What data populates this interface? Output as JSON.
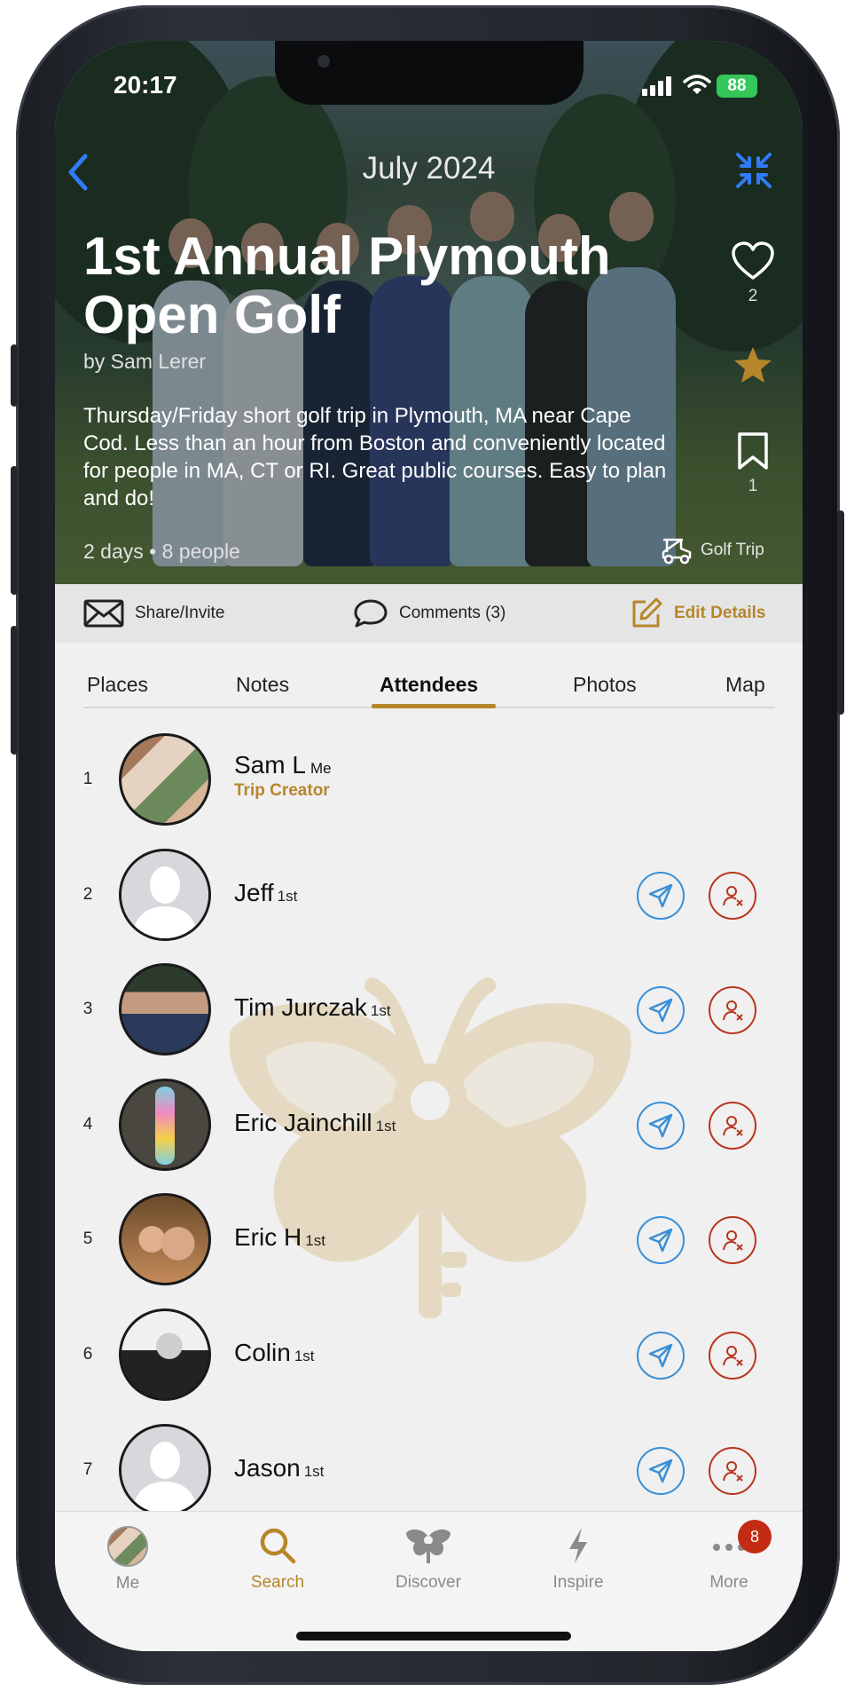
{
  "status_bar": {
    "time": "20:17",
    "battery": "88"
  },
  "header": {
    "title": "July 2024",
    "back_icon": "chevron-left-icon",
    "collapse_icon": "collapse-arrows-icon"
  },
  "trip": {
    "title": "1st Annual Plymouth Open Golf",
    "author": "by Sam Lerer",
    "description": "Thursday/Friday short golf trip in Plymouth, MA near Cape Cod. Less than an hour from Boston and conveniently located for people in MA, CT or RI. Great public courses. Easy to plan and do!",
    "meta": "2 days • 8 people",
    "type": "Golf Trip",
    "likes": "2",
    "saves": "1"
  },
  "actions": {
    "share": "Share/Invite",
    "comments": "Comments (3)",
    "edit": "Edit Details"
  },
  "tabs": [
    "Places",
    "Notes",
    "Attendees",
    "Photos",
    "Map"
  ],
  "active_tab": "Attendees",
  "attendees": [
    {
      "rank": "1",
      "name": "Sam L",
      "tag": "Me",
      "role": "Trip Creator"
    },
    {
      "rank": "2",
      "name": "Jeff",
      "tag": "1st"
    },
    {
      "rank": "3",
      "name": "Tim Jurczak",
      "tag": "1st"
    },
    {
      "rank": "4",
      "name": "Eric Jainchill",
      "tag": "1st"
    },
    {
      "rank": "5",
      "name": "Eric H",
      "tag": "1st"
    },
    {
      "rank": "6",
      "name": "Colin",
      "tag": "1st"
    },
    {
      "rank": "7",
      "name": "Jason",
      "tag": "1st"
    }
  ],
  "tabbar": {
    "me": "Me",
    "search": "Search",
    "discover": "Discover",
    "inspire": "Inspire",
    "more": "More",
    "more_badge": "8"
  },
  "colors": {
    "accent": "#b7862a",
    "blue": "#3a8fd6",
    "red": "#b8361f",
    "ios_blue": "#2f7cf6"
  }
}
